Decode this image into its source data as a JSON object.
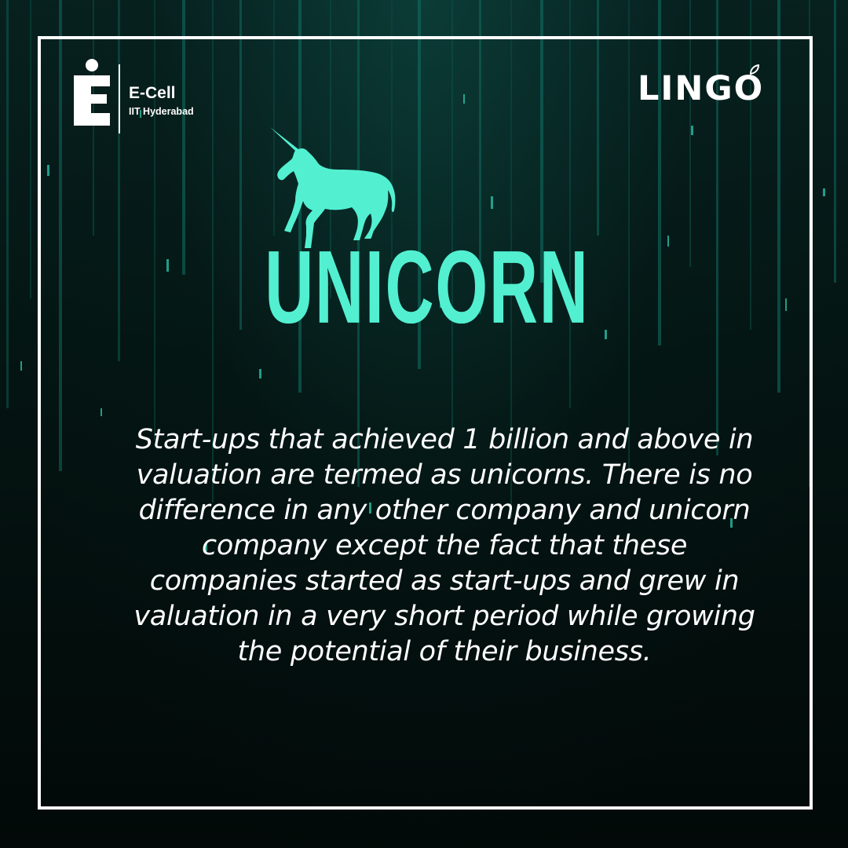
{
  "colors": {
    "accent": "#52f0d1",
    "text": "#ffffff",
    "background": "#041412",
    "frame": "#ffffff"
  },
  "header": {
    "ecell_logo": {
      "icon": "e-cell-logo-icon",
      "name": "E-Cell",
      "subtitle": "IIT Hyderabad"
    },
    "lingo_logo": {
      "text": "LINGO",
      "icon": "leaf-accent-icon"
    }
  },
  "main": {
    "icon": "unicorn-icon",
    "title": "UNICORN",
    "description": "Start-ups that achieved 1 billion and above in valuation are termed as unicorns. There is no difference in any other company and unicorn company except the fact that these companies started as start-ups and grew in valuation in a very short period while growing the potential of their business."
  }
}
